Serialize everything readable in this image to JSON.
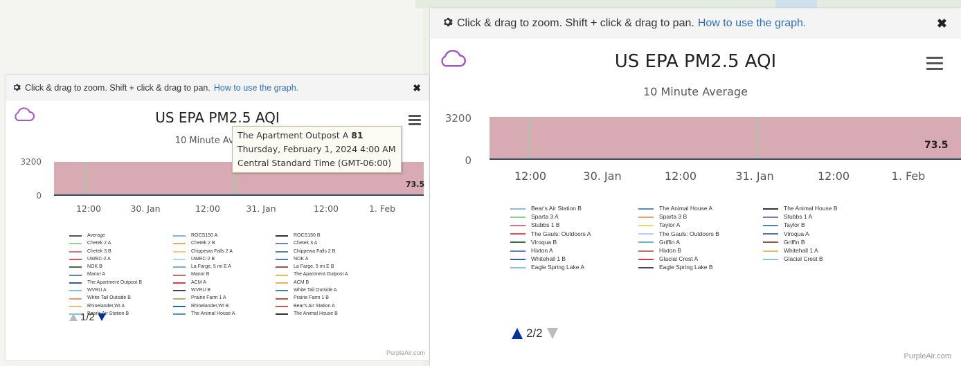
{
  "colors": {
    "plot_band": "#d7aab4",
    "accent_link": "#2f6fb8",
    "pager_active": "#003399",
    "pager_disabled": "#bbbbbb"
  },
  "common": {
    "hint_text": "Click & drag to zoom. Shift + click & drag to pan.",
    "hint_link": "How to use the graph.",
    "close_glyph": "✖",
    "gear_icon": "gear-icon",
    "cloud_icon": "cloud-icon",
    "menu_icon": "hamburger-menu-icon",
    "credit": "PurpleAir.com"
  },
  "panel_a": {
    "chart_data": {
      "type": "area",
      "title": "US EPA PM2.5 AQI",
      "subtitle": "10 Minute Average",
      "yticks": [
        "3200",
        "0"
      ],
      "xticks": [
        "12:00",
        "30. Jan",
        "12:00",
        "31. Jan",
        "12:00",
        "1. Feb"
      ],
      "last_value_label": "73.5",
      "ylim": [
        0,
        3200
      ]
    },
    "tooltip": {
      "line1": "The Apartment Outpost A ",
      "value": "81",
      "line2": "Thursday, February 1, 2024 4:00 AM",
      "line3": "Central Standard Time (GMT-06:00)"
    },
    "legend": [
      {
        "name": "Average",
        "color": "#555555"
      },
      {
        "name": "ROCS150 A",
        "color": "#7fb3e0"
      },
      {
        "name": "ROCS150 B",
        "color": "#333333"
      },
      {
        "name": "Chetek 2 A",
        "color": "#9ad0a0"
      },
      {
        "name": "Chetek 2 B",
        "color": "#f0a070"
      },
      {
        "name": "Chetek 3 A",
        "color": "#6b7fb0"
      },
      {
        "name": "Chetek 3 B",
        "color": "#e07080"
      },
      {
        "name": "Chippewa Falls 2 A",
        "color": "#f0d070"
      },
      {
        "name": "Chippewa Falls 2 B",
        "color": "#4a88b0"
      },
      {
        "name": "UWEC-2 A",
        "color": "#e05050"
      },
      {
        "name": "UWEC-2 B",
        "color": "#b8d0e8"
      },
      {
        "name": "NOK A",
        "color": "#5070c0"
      },
      {
        "name": "NOK B",
        "color": "#407040"
      },
      {
        "name": "La Farge, 5 mi E A",
        "color": "#70b0e0"
      },
      {
        "name": "La Farge, 5 mi E B",
        "color": "#a05050"
      },
      {
        "name": "Manor A",
        "color": "#6080c0"
      },
      {
        "name": "Manor B",
        "color": "#c07070"
      },
      {
        "name": "The Apartment Outpost A",
        "color": "#e0c060"
      },
      {
        "name": "The Apartment Outpost B",
        "color": "#3060a0"
      },
      {
        "name": "ACM A",
        "color": "#d04040"
      },
      {
        "name": "ACM B",
        "color": "#f0b050"
      },
      {
        "name": "WVRU A",
        "color": "#80c0e0"
      },
      {
        "name": "WVRU B",
        "color": "#404060"
      },
      {
        "name": "White Tail Outside A",
        "color": "#4080c0"
      },
      {
        "name": "White Tail Outside B",
        "color": "#e0a060"
      },
      {
        "name": "Prairie Farm 1 A",
        "color": "#90c070"
      },
      {
        "name": "Prairie Farm 1 B",
        "color": "#c05050"
      },
      {
        "name": "Rhinelander,WI A",
        "color": "#e0c070"
      },
      {
        "name": "Rhinelander,WI B",
        "color": "#3060a0"
      },
      {
        "name": "Bear's Air Station A",
        "color": "#d05050"
      },
      {
        "name": "Bear's Air Station B",
        "color": "#80c0e0"
      },
      {
        "name": "The Animal House A",
        "color": "#5090d0"
      },
      {
        "name": "The Animal House B",
        "color": "#333333"
      }
    ],
    "pager": {
      "text": "1/2"
    }
  },
  "panel_b": {
    "chart_data": {
      "type": "area",
      "title": "US EPA PM2.5 AQI",
      "subtitle": "10 Minute Average",
      "yticks": [
        "3200",
        "0"
      ],
      "xticks": [
        "12:00",
        "30. Jan",
        "12:00",
        "31. Jan",
        "12:00",
        "1. Feb"
      ],
      "last_value_label": "73.5",
      "ylim": [
        0,
        3200
      ]
    },
    "legend": [
      {
        "name": "Bear's Air Station B",
        "color": "#80c0e0"
      },
      {
        "name": "The Animal House A",
        "color": "#5090d0"
      },
      {
        "name": "The Animal House B",
        "color": "#333333"
      },
      {
        "name": "Sparta 3 A",
        "color": "#8fd08f"
      },
      {
        "name": "Sparta 3 B",
        "color": "#f0a070"
      },
      {
        "name": "Stubbs 1 A",
        "color": "#7080b0"
      },
      {
        "name": "Stubbs 1 B",
        "color": "#e07080"
      },
      {
        "name": "Taylor A",
        "color": "#f0d070"
      },
      {
        "name": "Taylor B",
        "color": "#4a88b0"
      },
      {
        "name": "The Gauls: Outdoors A",
        "color": "#e05050"
      },
      {
        "name": "The Gauls: Outdoors B",
        "color": "#b8d0e8"
      },
      {
        "name": "Viroqua A",
        "color": "#5070c0"
      },
      {
        "name": "Viroqua B",
        "color": "#407040"
      },
      {
        "name": "Griffin A",
        "color": "#70b0e0"
      },
      {
        "name": "Griffin B",
        "color": "#a05050"
      },
      {
        "name": "Hixton A",
        "color": "#6080c0"
      },
      {
        "name": "Hixton B",
        "color": "#c07070"
      },
      {
        "name": "Whitehall 1 A",
        "color": "#e0c060"
      },
      {
        "name": "Whitehall 1 B",
        "color": "#3060a0"
      },
      {
        "name": "Glacial Crest A",
        "color": "#d04040"
      },
      {
        "name": "Glacial Crest B",
        "color": "#80c8e8"
      },
      {
        "name": "Eagle Spring Lake A",
        "color": "#80c0e0"
      },
      {
        "name": "Eagle Spring Lake B",
        "color": "#404060"
      }
    ],
    "pager": {
      "text": "2/2"
    }
  }
}
